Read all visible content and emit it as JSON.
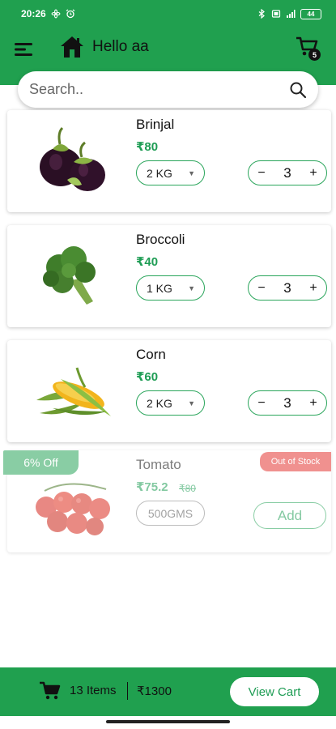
{
  "status_bar": {
    "time": "20:26",
    "battery": "44",
    "left_icons": [
      "fan-icon",
      "alarm-icon"
    ],
    "right_icons": [
      "bluetooth-icon",
      "sim-icon",
      "signal-icon"
    ]
  },
  "header": {
    "greeting": "Hello aa",
    "cart_count": "5"
  },
  "search": {
    "placeholder": "Search.."
  },
  "products": [
    {
      "name": "Brinjal",
      "price": "₹80",
      "weight": "2 KG",
      "quantity": "3"
    },
    {
      "name": "Broccoli",
      "price": "₹40",
      "weight": "1 KG",
      "quantity": "3"
    },
    {
      "name": "Corn",
      "price": "₹60",
      "weight": "2 KG",
      "quantity": "3"
    },
    {
      "name": "Tomato",
      "price": "₹75.2",
      "old_price": "₹80",
      "weight": "500GMS",
      "discount": "6% Off",
      "stock_status": "Out of Stock",
      "add_label": "Add"
    }
  ],
  "stepper": {
    "minus": "−",
    "plus": "+"
  },
  "bottom_bar": {
    "items": "13 Items",
    "total": "₹1300",
    "button": "View Cart"
  },
  "colors": {
    "brand_green": "#20a04f",
    "price_green": "#1f9d55",
    "out_of_stock_red": "#e53935"
  }
}
